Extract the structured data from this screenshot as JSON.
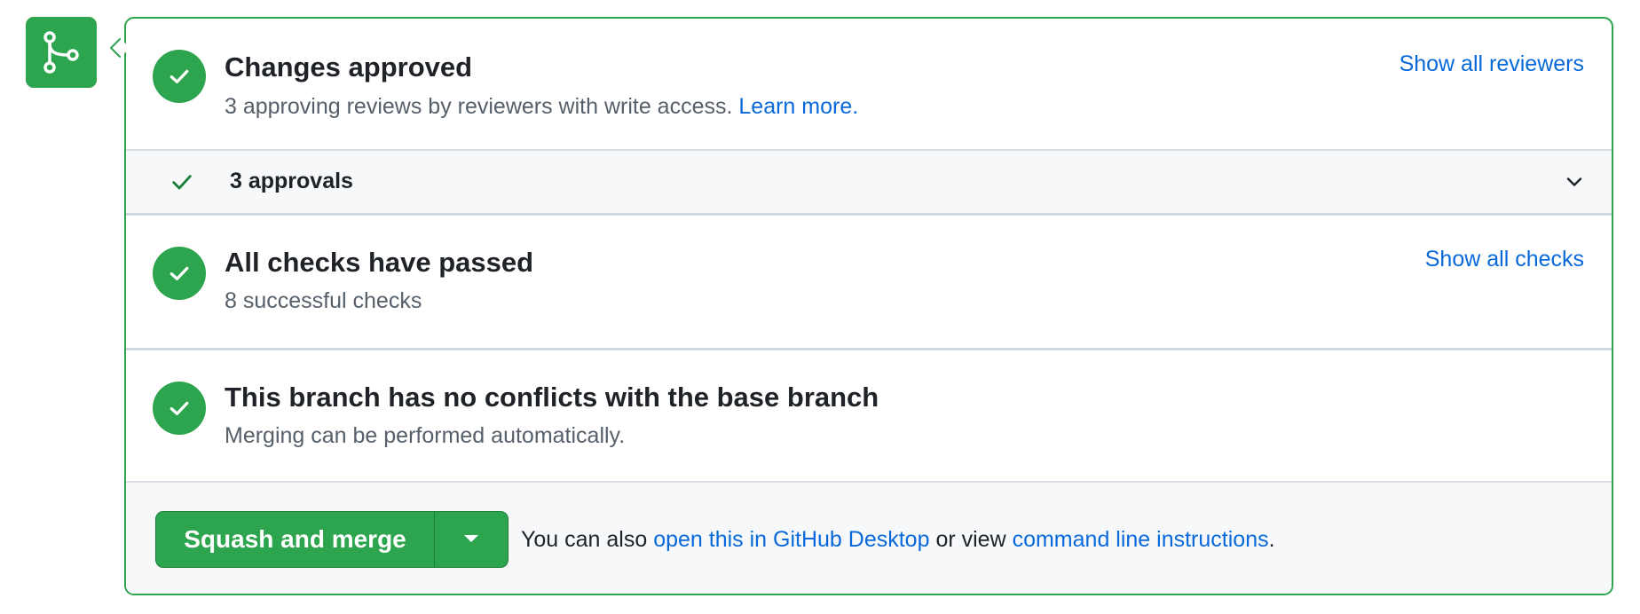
{
  "reviews": {
    "title": "Changes approved",
    "subtitle": "3 approving reviews by reviewers with write access.",
    "learn_more": "Learn more.",
    "show_all": "Show all reviewers"
  },
  "approvals": {
    "label": "3 approvals"
  },
  "checks": {
    "title": "All checks have passed",
    "subtitle": "8 successful checks",
    "show_all": "Show all checks"
  },
  "conflicts": {
    "title": "This branch has no conflicts with the base branch",
    "subtitle": "Merging can be performed automatically."
  },
  "merge": {
    "button_label": "Squash and merge",
    "text_prefix": "You can also",
    "desktop_link": "open this in GitHub Desktop",
    "text_middle": "or view",
    "cli_link": "command line instructions",
    "text_suffix": "."
  },
  "colors": {
    "success": "#2da44e",
    "link": "#0969da"
  },
  "icons": {
    "badge": "git-merge-icon",
    "status": "check-circle-icon",
    "approvals": "check-icon",
    "expand": "chevron-down-icon",
    "dropdown": "triangle-down-icon"
  }
}
